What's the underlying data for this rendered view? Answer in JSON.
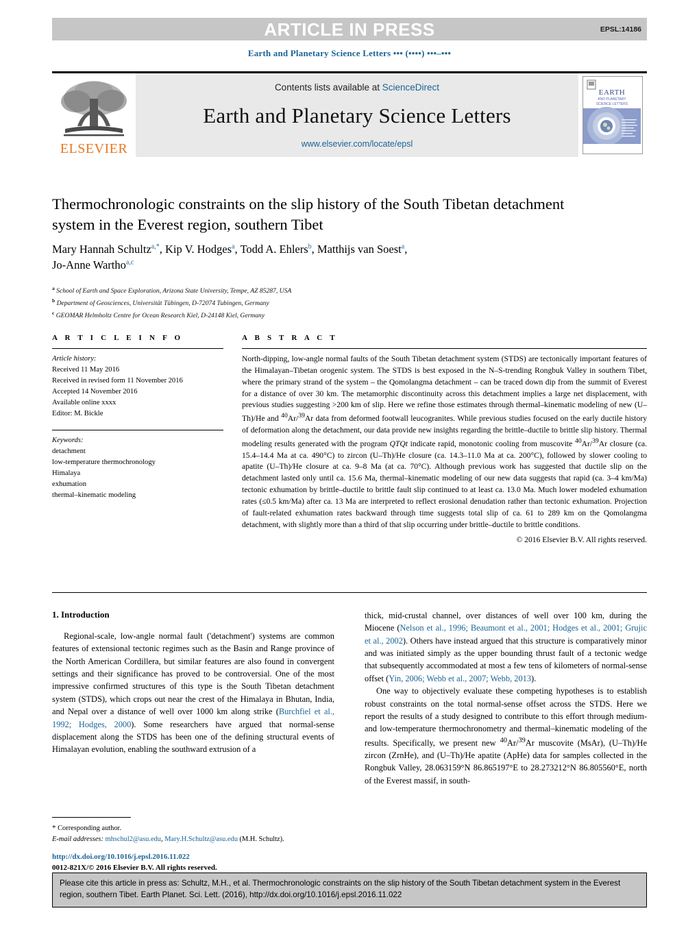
{
  "band": {
    "label": "ARTICLE IN PRESS",
    "code": "EPSL:14186",
    "bg_color": "#c6c6c6"
  },
  "running_head": "Earth and Planetary Science Letters ••• (••••) •••–•••",
  "masthead": {
    "publisher": "ELSEVIER",
    "contents_prefix": "Contents lists available at ",
    "contents_link": "ScienceDirect",
    "journal_title": "Earth and Planetary Science Letters",
    "journal_url": "www.elsevier.com/locate/epsl",
    "cover_title_line1": "EARTH",
    "cover_title_line2": "AND PLANETARY",
    "cover_title_line3": "SCIENCE LETTERS",
    "link_color": "#1a6496",
    "publisher_color": "#e87722"
  },
  "article": {
    "title": "Thermochronologic constraints on the slip history of the South Tibetan detachment system in the Everest region, southern Tibet",
    "authors_line1": "Mary Hannah Schultz",
    "authors_html_note": "rendered inline in template",
    "affiliations": [
      {
        "marker": "a",
        "text": "School of Earth and Space Exploration, Arizona State University, Tempe, AZ 85287, USA"
      },
      {
        "marker": "b",
        "text": "Department of Geosciences, Universität Tübingen, D-72074 Tubingen, Germany"
      },
      {
        "marker": "c",
        "text": "GEOMAR Helmholtz Centre for Ocean Research Kiel, D-24148 Kiel, Germany"
      }
    ]
  },
  "authors": [
    {
      "name": "Mary Hannah Schultz",
      "sup": "a,*"
    },
    {
      "name": "Kip V. Hodges",
      "sup": "a"
    },
    {
      "name": "Todd A. Ehlers",
      "sup": "b"
    },
    {
      "name": "Matthijs van Soest",
      "sup": "a"
    },
    {
      "name": "Jo-Anne Wartho",
      "sup": "a,c"
    }
  ],
  "info": {
    "heading": "A R T I C L E   I N F O",
    "history_label": "Article history:",
    "history": [
      "Received 11 May 2016",
      "Received in revised form 11 November 2016",
      "Accepted 14 November 2016",
      "Available online xxxx",
      "Editor: M. Bickle"
    ],
    "keywords_label": "Keywords:",
    "keywords": [
      "detachment",
      "low-temperature thermochronology",
      "Himalaya",
      "exhumation",
      "thermal–kinematic modeling"
    ]
  },
  "abstract": {
    "heading": "A B S T R A C T",
    "paragraph_1": "North-dipping, low-angle normal faults of the South Tibetan detachment system (STDS) are tectonically important features of the Himalayan–Tibetan orogenic system. The STDS is best exposed in the N–S-trending Rongbuk Valley in southern Tibet, where the primary strand of the system – the Qomolangma detachment – can be traced down dip from the summit of Everest for a distance of over 30 km. The metamorphic discontinuity across this detachment implies a large net displacement, with previous studies suggesting >200 km of slip. Here we refine those estimates through thermal–kinematic modeling of new (U–Th)/He and ",
    "isotope_1": "40Ar/39Ar",
    "paragraph_2": " data from deformed footwall leucogranites. While previous studies focused on the early ductile history of deformation along the detachment, our data provide new insights regarding the brittle–ductile to brittle slip history. Thermal modeling results generated with the program ",
    "program_name": "QTQt",
    "paragraph_3": " indicate rapid, monotonic cooling from muscovite ",
    "isotope_2": "40Ar/39Ar",
    "paragraph_4": " closure (ca. 15.4–14.4 Ma at ca. 490°C) to zircon (U–Th)/He closure (ca. 14.3–11.0 Ma at ca. 200°C), followed by slower cooling to apatite (U–Th)/He closure at ca. 9–8 Ma (at ca. 70°C). Although previous work has suggested that ductile slip on the detachment lasted only until ca. 15.6 Ma, thermal–kinematic modeling of our new data suggests that rapid (ca. 3–4 km/Ma) tectonic exhumation by brittle–ductile to brittle fault slip continued to at least ca. 13.0 Ma. Much lower modeled exhumation rates (≤0.5 km/Ma) after ca. 13 Ma are interpreted to reflect erosional denudation rather than tectonic exhumation. Projection of fault-related exhumation rates backward through time suggests total slip of ca. 61 to 289 km on the Qomolangma detachment, with slightly more than a third of that slip occurring under brittle–ductile to brittle conditions.",
    "copyright": "© 2016 Elsevier B.V. All rights reserved."
  },
  "intro": {
    "heading": "1. Introduction",
    "left_p1_a": "Regional-scale, low-angle normal fault ('detachment') systems are common features of extensional tectonic regimes such as the Basin and Range province of the North American Cordillera, but similar features are also found in convergent settings and their significance has proved to be controversial. One of the most impressive confirmed structures of this type is the South Tibetan detachment system (STDS), which crops out near the crest of the Himalaya in Bhutan, India, and Nepal over a distance of well over 1000 km along strike (",
    "left_cite_1": "Burchfiel et al., 1992; Hodges, 2000",
    "left_p1_b": "). Some researchers have argued that normal-sense displacement along the STDS has been one of the defining structural events of Himalayan evolution, enabling the southward extrusion of a",
    "right_p1_a": "thick, mid-crustal channel, over distances of well over 100 km, during the Miocene (",
    "right_cite_1": "Nelson et al., 1996; Beaumont et al., 2001; Hodges et al., 2001; Grujic et al., 2002",
    "right_p1_b": "). Others have instead argued that this structure is comparatively minor and was initiated simply as the upper bounding thrust fault of a tectonic wedge that subsequently accommodated at most a few tens of kilometers of normal-sense offset (",
    "right_cite_2": "Yin, 2006; Webb et al., 2007; Webb, 2013",
    "right_p1_c": ").",
    "right_p2_a": "One way to objectively evaluate these competing hypotheses is to establish robust constraints on the total normal-sense offset across the STDS. Here we report the results of a study designed to contribute to this effort through medium- and low-temperature thermochronometry and thermal–kinematic modeling of the results. Specifically, we present new ",
    "right_isotope": "40Ar/39Ar",
    "right_p2_b": " muscovite (MsAr), (U–Th)/He zircon (ZrnHe), and (U–Th)/He apatite (ApHe) data for samples collected in the Rongbuk Valley, 28.063159°N 86.865197°E to 28.273212°N 86.805560°E, north of the Everest massif, in south-"
  },
  "footnote": {
    "star": "*",
    "corresponding": "Corresponding author.",
    "email_label": "E-mail addresses:",
    "email_1": "mhschul2@asu.edu",
    "email_sep": ", ",
    "email_2": "Mary.H.Schultz@asu.edu",
    "email_suffix": " (M.H. Schultz)."
  },
  "doi": {
    "url": "http://dx.doi.org/10.1016/j.epsl.2016.11.022",
    "issn": "0012-821X/© 2016 Elsevier B.V. All rights reserved."
  },
  "cite_box": {
    "text": "Please cite this article in press as: Schultz, M.H., et al. Thermochronologic constraints on the slip history of the South Tibetan detachment system in the Everest region, southern Tibet. Earth Planet. Sci. Lett. (2016), http://dx.doi.org/10.1016/j.epsl.2016.11.022",
    "bg_color": "#c6c6c6"
  }
}
